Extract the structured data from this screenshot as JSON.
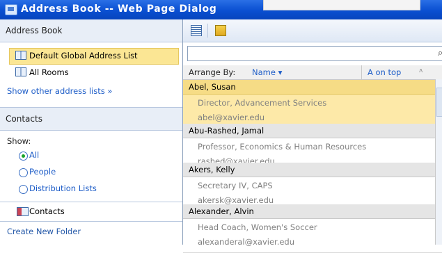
{
  "window": {
    "title": "Address Book -- Web Page Dialog"
  },
  "left": {
    "address_book_header": "Address Book",
    "address_lists": [
      {
        "label": "Default Global Address List",
        "selected": true
      },
      {
        "label": "All Rooms",
        "selected": false
      }
    ],
    "show_other_link": "Show other address lists »",
    "contacts_header": "Contacts",
    "show_label": "Show:",
    "filters": [
      {
        "label": "All",
        "checked": true
      },
      {
        "label": "People",
        "checked": false
      },
      {
        "label": "Distribution Lists",
        "checked": false
      }
    ],
    "contacts_folder": "Contacts",
    "create_folder_link": "Create New Folder"
  },
  "right": {
    "arrange_by_label": "Arrange By:",
    "arrange_by_value": "Name ▾",
    "sort_label": "A on top",
    "sort_glyph": "ʌ",
    "contacts": [
      {
        "name": "Abel, Susan",
        "title": "Director, Advancement Services",
        "email": "abel@xavier.edu",
        "selected": true
      },
      {
        "name": "Abu-Rashed, Jamal",
        "title": "Professor, Economics & Human Resources",
        "email": "rashed@xavier.edu",
        "selected": false
      },
      {
        "name": "Akers, Kelly",
        "title": "Secretary IV, CAPS",
        "email": "akersk@xavier.edu",
        "selected": false
      },
      {
        "name": "Alexander, Alvin",
        "title": "Head Coach, Women's Soccer",
        "email": "alexanderal@xavier.edu",
        "selected": false
      }
    ]
  },
  "colors": {
    "titlebar": "#0a4fd1",
    "selection": "#fbe694",
    "link": "#1f5ec8"
  }
}
